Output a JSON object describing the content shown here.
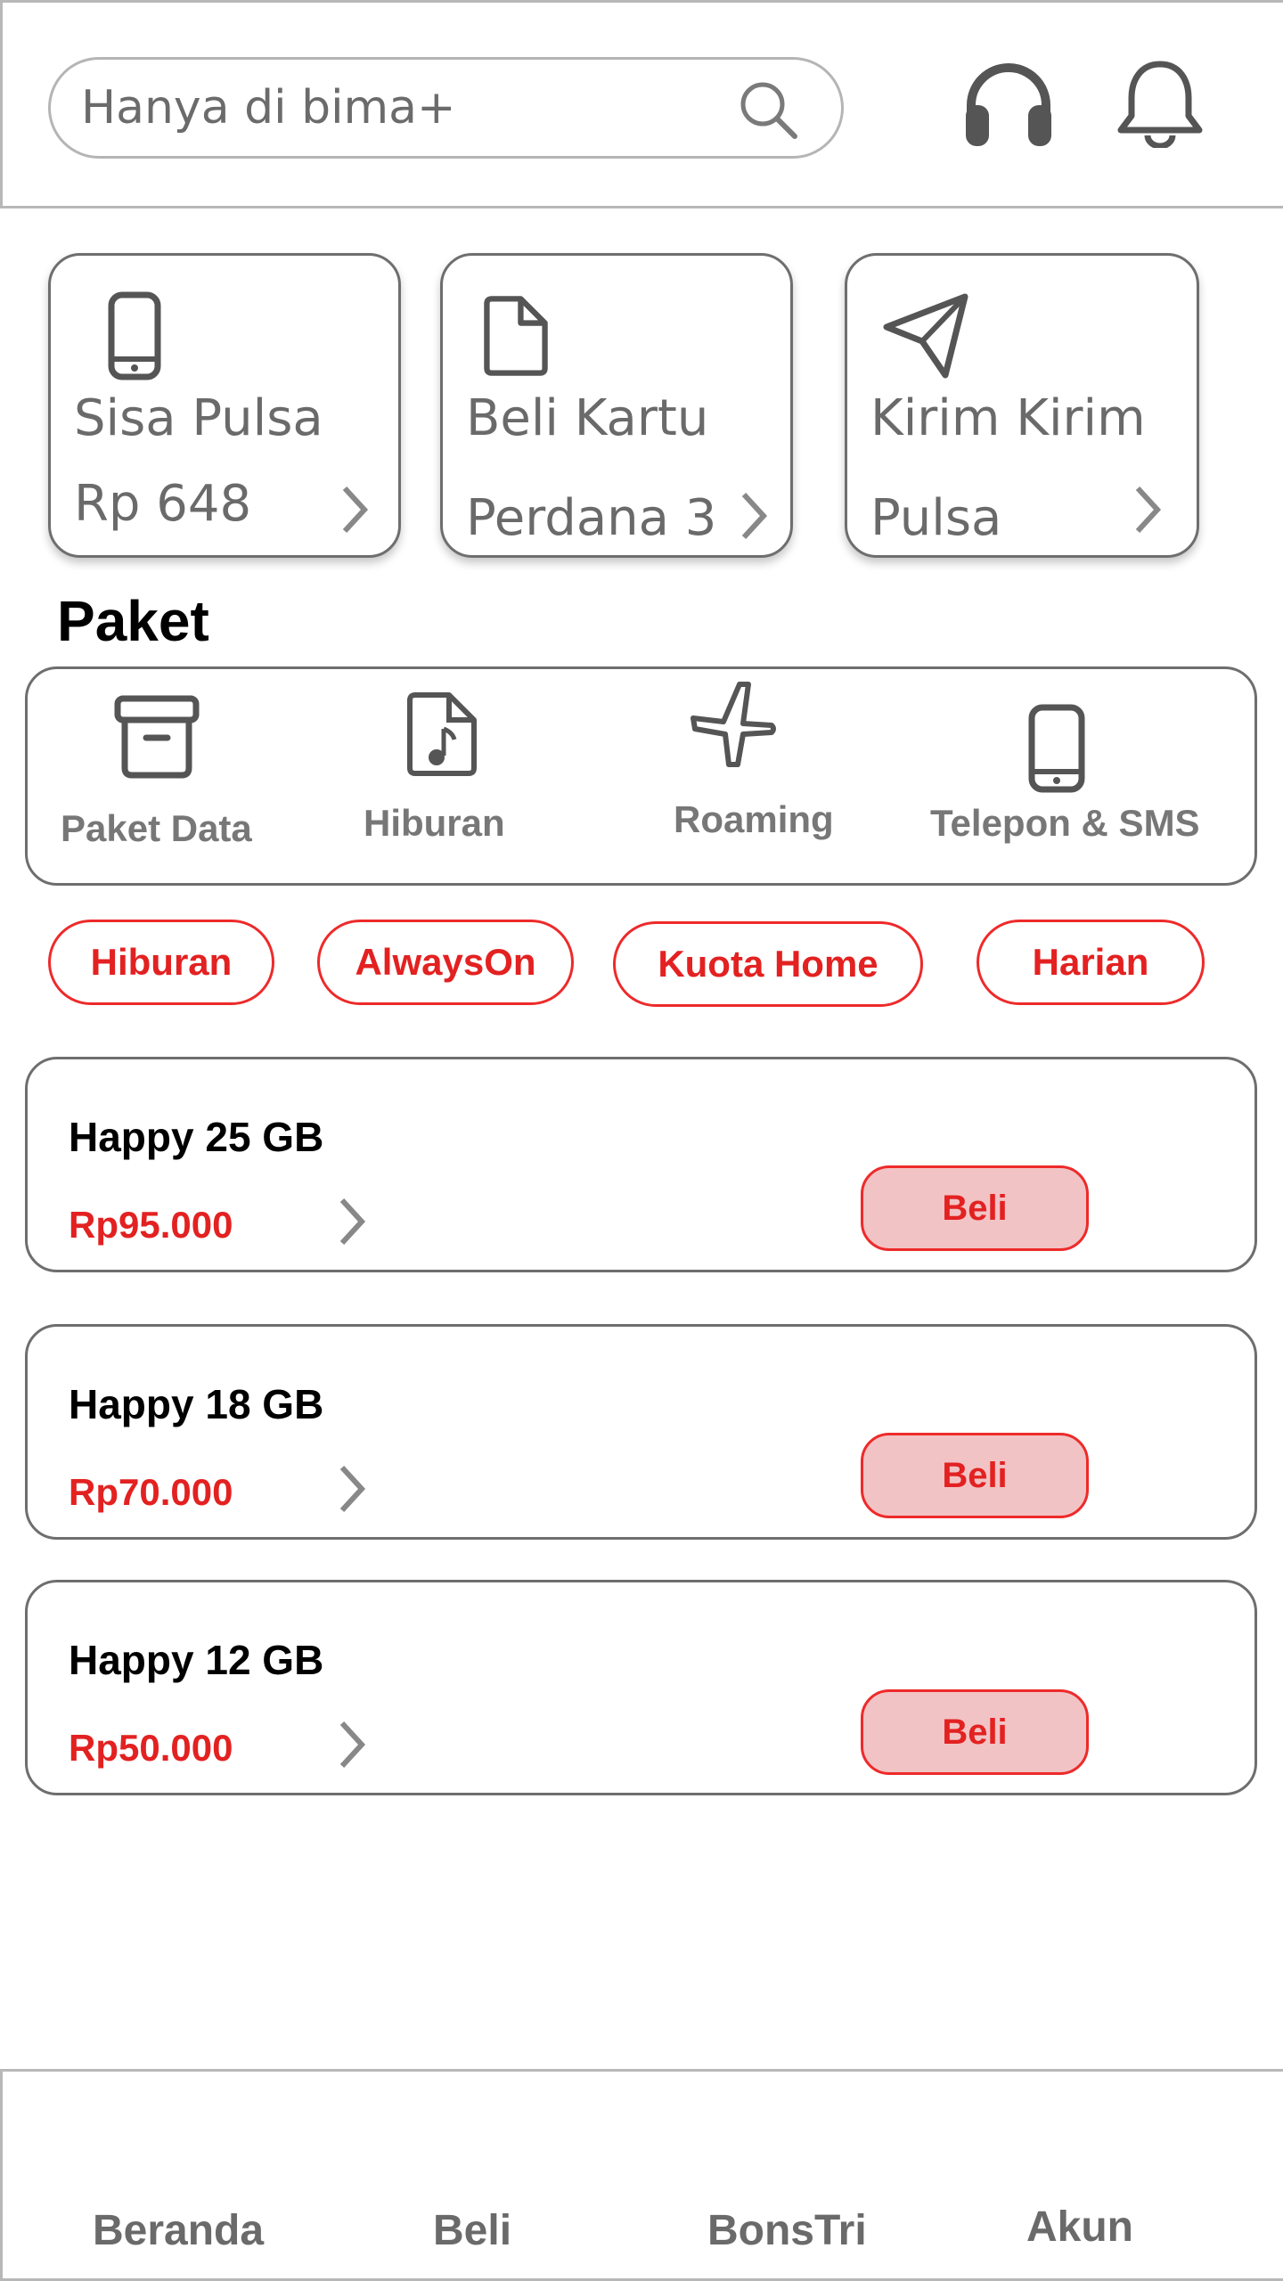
{
  "search": {
    "placeholder": "Hanya di bima+"
  },
  "header_icons": [
    "search-icon",
    "headset-icon",
    "bell-icon"
  ],
  "quick_cards": [
    {
      "icon": "phone-icon",
      "title": "Sisa Pulsa",
      "subtitle": "Rp 648"
    },
    {
      "icon": "file-icon",
      "title": "Beli Kartu",
      "subtitle": "Perdana 3"
    },
    {
      "icon": "send-icon",
      "title": "Kirim Kirim",
      "subtitle": "Pulsa"
    }
  ],
  "paket": {
    "title": "Paket",
    "categories": [
      {
        "icon": "archive-icon",
        "label": "Paket Data"
      },
      {
        "icon": "music-file-icon",
        "label": "Hiburan"
      },
      {
        "icon": "airplane-icon",
        "label": "Roaming"
      },
      {
        "icon": "phone-icon",
        "label": "Telepon & SMS"
      }
    ]
  },
  "filters": [
    "Hiburan",
    "AlwaysOn",
    "Kuota Home",
    "Harian"
  ],
  "products": [
    {
      "name": "Happy 25 GB",
      "price": "Rp95.000",
      "buy_label": "Beli"
    },
    {
      "name": "Happy 18 GB",
      "price": "Rp70.000",
      "buy_label": "Beli"
    },
    {
      "name": "Happy 12 GB",
      "price": "Rp50.000",
      "buy_label": "Beli"
    }
  ],
  "bottom_nav": [
    "Beranda",
    "Beli",
    "BonsTri",
    "Akun"
  ],
  "colors": {
    "accent": "#e32121",
    "accent_light": "#f2c3c5",
    "border": "#6e6e6e",
    "text_muted": "#6a6a6a"
  }
}
